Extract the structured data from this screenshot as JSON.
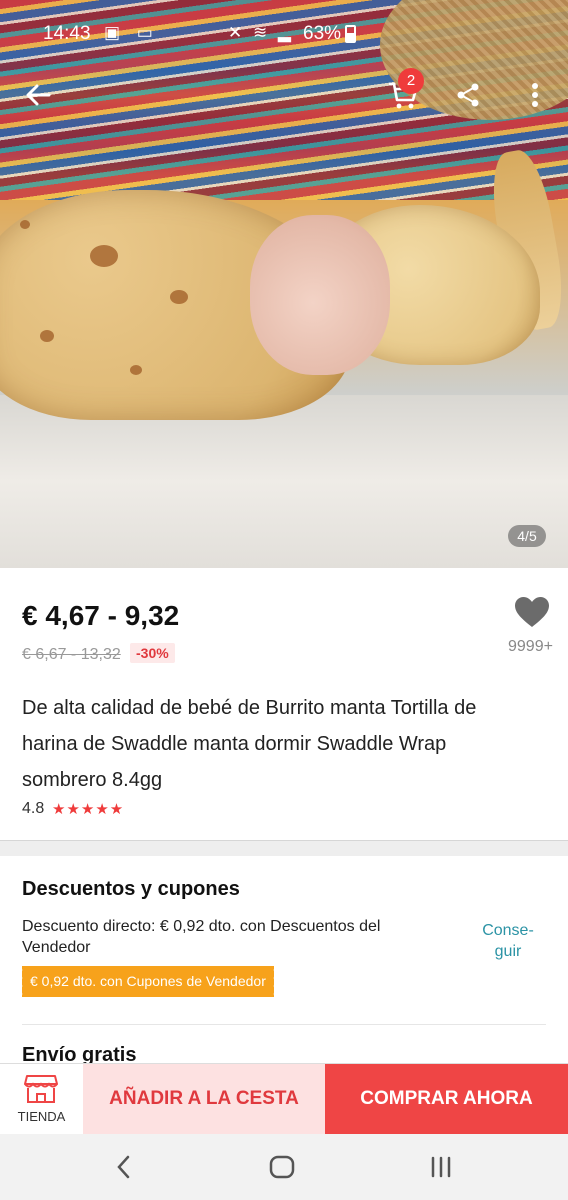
{
  "status_bar": {
    "time": "14:43",
    "battery": "63%"
  },
  "hero": {
    "cart_count": "2",
    "image_counter": "4/5"
  },
  "product": {
    "price": "€ 4,67 - 9,32",
    "old_price": "€ 6,67 - 13,32",
    "discount": "-30%",
    "wishlist_count": "9999+",
    "title": "De alta calidad de bebé de Burrito manta Tortilla de harina de Swaddle manta dormir Swaddle Wrap sombrero 8.4gg",
    "rating": "4.8",
    "stars": "★★★★★"
  },
  "discounts": {
    "title": "Descuentos y cupones",
    "direct_text": "Descuento directo: € 0,92 dto. con Descuentos del Vendedor",
    "get_label": "Conse-guir",
    "coupon": "€ 0,92 dto. con Cupones de Vendedor",
    "shipping": "Envío gratis"
  },
  "actions": {
    "store_label": "TIENDA",
    "add_to_cart": "AÑADIR A LA CESTA",
    "buy_now": "COMPRAR AHORA"
  },
  "colors": {
    "accent": "#ef4545",
    "coupon": "#f7a21b",
    "link": "#2b93a5"
  }
}
